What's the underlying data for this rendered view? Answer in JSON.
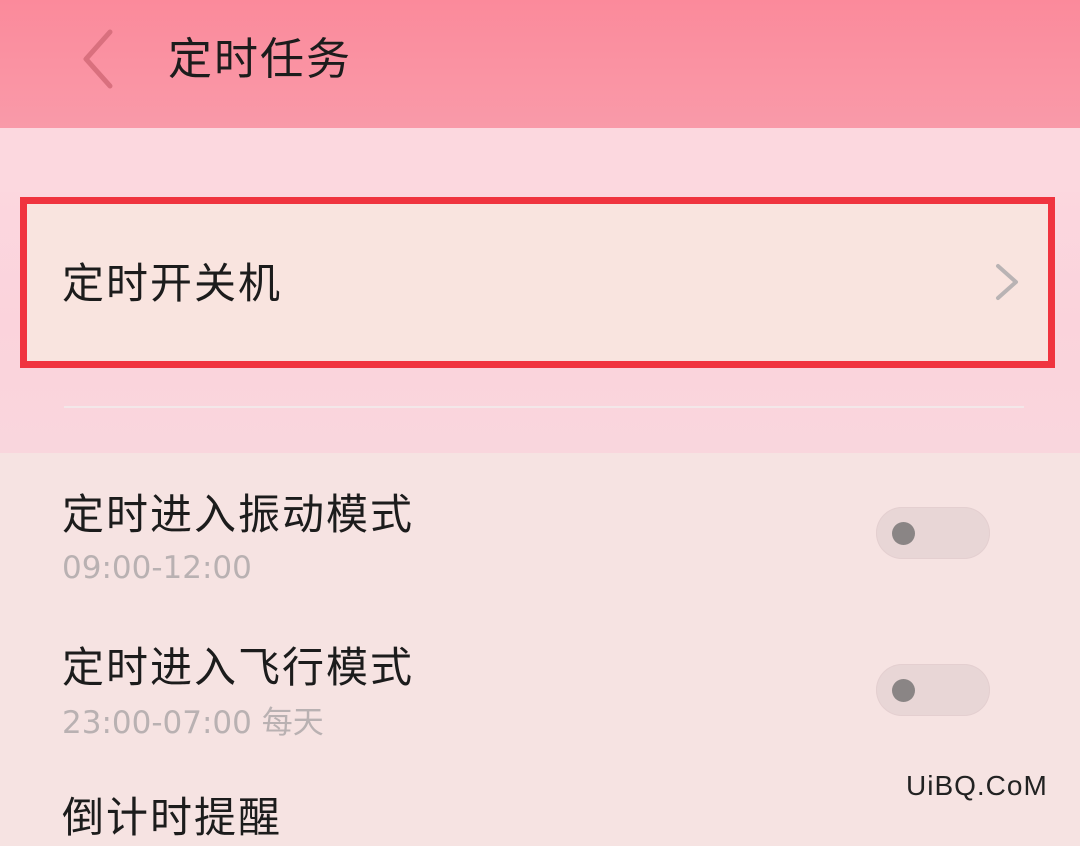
{
  "header": {
    "title": "定时任务",
    "back_icon": "chevron-left-icon",
    "background": "#fb8a9b"
  },
  "settings": {
    "scheduled_power": {
      "label": "定时开关机",
      "icon": "chevron-right-icon",
      "highlight_color": "#f0343f"
    },
    "items": [
      {
        "title": "定时进入振动模式",
        "subtitle": "09:00-12:00",
        "enabled": false
      },
      {
        "title": "定时进入飞行模式",
        "subtitle": "23:00-07:00 每天",
        "enabled": false
      }
    ],
    "partial_item_title": "倒计时提醒"
  },
  "watermark": "UiBQ.CoM"
}
